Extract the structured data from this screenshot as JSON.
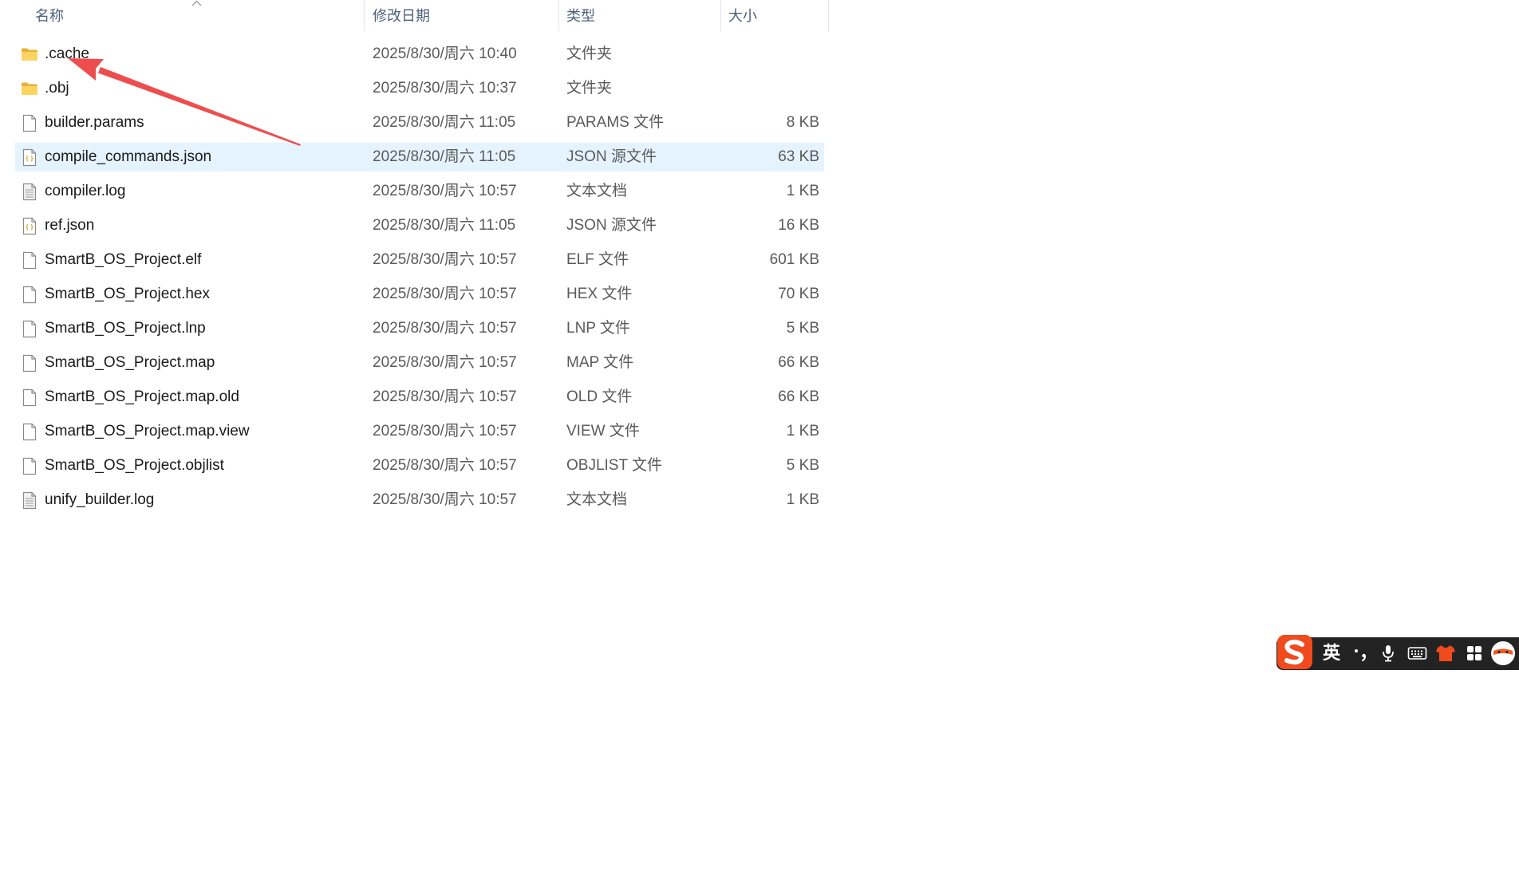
{
  "header": {
    "sort_icon": "chevron-up-icon",
    "columns": [
      {
        "label": "名称"
      },
      {
        "label": "修改日期"
      },
      {
        "label": "类型"
      },
      {
        "label": "大小"
      }
    ]
  },
  "files": [
    {
      "name": ".cache",
      "date": "2025/8/30/周六 10:40",
      "type": "文件夹",
      "size": "",
      "icon": "folder-icon"
    },
    {
      "name": ".obj",
      "date": "2025/8/30/周六 10:37",
      "type": "文件夹",
      "size": "",
      "icon": "folder-icon"
    },
    {
      "name": "builder.params",
      "date": "2025/8/30/周六 11:05",
      "type": "PARAMS 文件",
      "size": "8 KB",
      "icon": "file-icon"
    },
    {
      "name": "compile_commands.json",
      "date": "2025/8/30/周六 11:05",
      "type": "JSON 源文件",
      "size": "63 KB",
      "icon": "json-file-icon",
      "selected": true
    },
    {
      "name": "compiler.log",
      "date": "2025/8/30/周六 10:57",
      "type": "文本文档",
      "size": "1 KB",
      "icon": "text-file-icon"
    },
    {
      "name": "ref.json",
      "date": "2025/8/30/周六 11:05",
      "type": "JSON 源文件",
      "size": "16 KB",
      "icon": "json-file-icon"
    },
    {
      "name": "SmartB_OS_Project.elf",
      "date": "2025/8/30/周六 10:57",
      "type": "ELF 文件",
      "size": "601 KB",
      "icon": "file-icon"
    },
    {
      "name": "SmartB_OS_Project.hex",
      "date": "2025/8/30/周六 10:57",
      "type": "HEX 文件",
      "size": "70 KB",
      "icon": "file-icon"
    },
    {
      "name": "SmartB_OS_Project.lnp",
      "date": "2025/8/30/周六 10:57",
      "type": "LNP 文件",
      "size": "5 KB",
      "icon": "file-icon"
    },
    {
      "name": "SmartB_OS_Project.map",
      "date": "2025/8/30/周六 10:57",
      "type": "MAP 文件",
      "size": "66 KB",
      "icon": "file-icon"
    },
    {
      "name": "SmartB_OS_Project.map.old",
      "date": "2025/8/30/周六 10:57",
      "type": "OLD 文件",
      "size": "66 KB",
      "icon": "file-icon"
    },
    {
      "name": "SmartB_OS_Project.map.view",
      "date": "2025/8/30/周六 10:57",
      "type": "VIEW 文件",
      "size": "1 KB",
      "icon": "file-icon"
    },
    {
      "name": "SmartB_OS_Project.objlist",
      "date": "2025/8/30/周六 10:57",
      "type": "OBJLIST 文件",
      "size": "5 KB",
      "icon": "file-icon"
    },
    {
      "name": "unify_builder.log",
      "date": "2025/8/30/周六 10:57",
      "type": "文本文档",
      "size": "1 KB",
      "icon": "text-file-icon"
    }
  ],
  "ime": {
    "language_label": "英",
    "icons": [
      "sogou-logo-icon",
      "punctuation-icon",
      "microphone-icon",
      "keyboard-icon",
      "skin-icon",
      "toolbox-icon",
      "avatar-icon"
    ]
  },
  "colors": {
    "header_text": "#4c607a",
    "selected_row": "#e5f3ff",
    "annotation_arrow": "#ee4d4e",
    "ime_background": "#232323",
    "ime_logo": "#f04a1d"
  }
}
